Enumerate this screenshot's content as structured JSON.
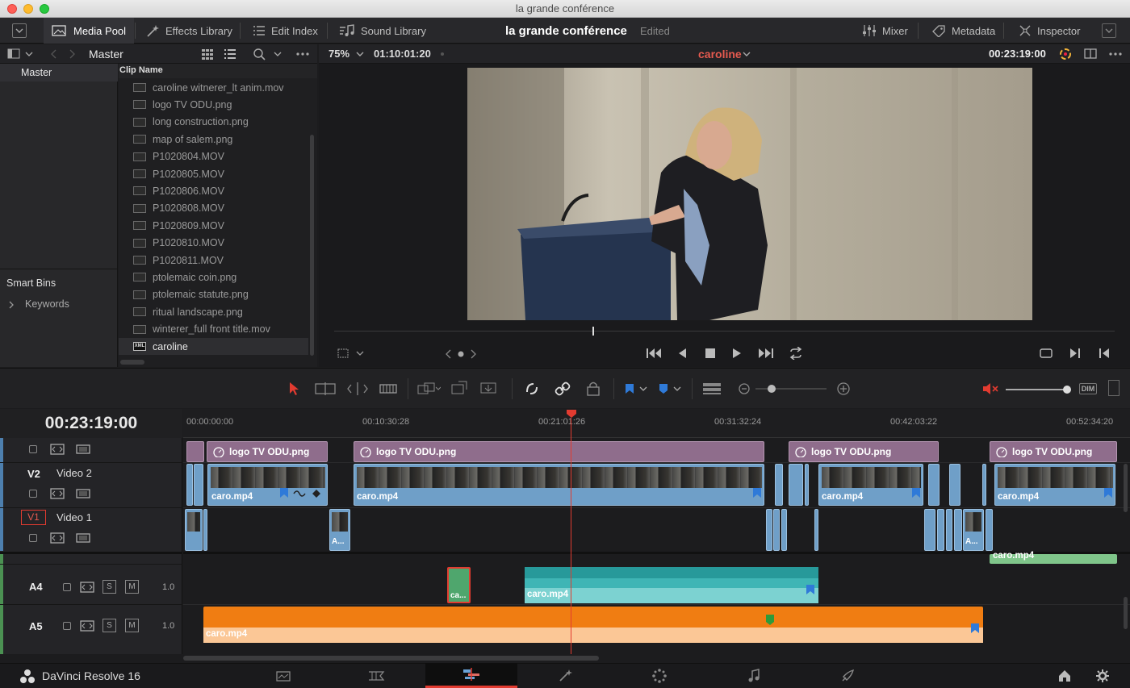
{
  "window": {
    "title": "la grande conférence"
  },
  "toolbar": {
    "media_pool": "Media Pool",
    "effects_library": "Effects Library",
    "edit_index": "Edit Index",
    "sound_library": "Sound Library",
    "project_title": "la grande conférence",
    "project_status": "Edited",
    "mixer": "Mixer",
    "metadata": "Metadata",
    "inspector": "Inspector"
  },
  "bins": {
    "current": "Master",
    "master": "Master",
    "smart_bins": "Smart Bins",
    "keywords": "Keywords",
    "column_header": "Clip Name"
  },
  "clips": [
    {
      "name": "caroline witnerer_lt anim.mov",
      "type": "clip"
    },
    {
      "name": "logo TV ODU.png",
      "type": "clip"
    },
    {
      "name": "long construction.png",
      "type": "clip"
    },
    {
      "name": "map of salem.png",
      "type": "clip"
    },
    {
      "name": "P1020804.MOV",
      "type": "clip"
    },
    {
      "name": "P1020805.MOV",
      "type": "clip"
    },
    {
      "name": "P1020806.MOV",
      "type": "clip"
    },
    {
      "name": "P1020808.MOV",
      "type": "clip"
    },
    {
      "name": "P1020809.MOV",
      "type": "clip"
    },
    {
      "name": "P1020810.MOV",
      "type": "clip"
    },
    {
      "name": "P1020811.MOV",
      "type": "clip"
    },
    {
      "name": "ptolemaic coin.png",
      "type": "clip"
    },
    {
      "name": "ptolemaic statute.png",
      "type": "clip"
    },
    {
      "name": "ritual landscape.png",
      "type": "clip"
    },
    {
      "name": "winterer_full front title.mov",
      "type": "clip"
    },
    {
      "name": "caroline",
      "type": "timeline",
      "badge": "XML"
    }
  ],
  "viewer": {
    "zoom": "75%",
    "source_timecode": "01:10:01:20",
    "timeline_name": "caroline",
    "record_timecode": "00:23:19:00"
  },
  "timeline": {
    "timecode": "00:23:19:00",
    "ruler_labels": [
      "00:00:00:00",
      "00:10:30:28",
      "00:21:01:26",
      "00:31:32:24",
      "00:42:03:22",
      "00:52:34:20"
    ],
    "dim_label": "DIM",
    "tracks": {
      "v2": {
        "id": "V2",
        "name": "Video 2"
      },
      "v1": {
        "id": "V1",
        "name": "Video 1"
      },
      "a4": {
        "id": "A4",
        "level": "1.0",
        "solo": "S",
        "mute": "M"
      },
      "a5": {
        "id": "A5",
        "level": "1.0",
        "solo": "S",
        "mute": "M"
      }
    },
    "clip_labels": {
      "title": "logo TV ODU.png",
      "video": "caro.mp4",
      "short_a": "A...",
      "short_ca": "ca...",
      "audio": "caro.mp4"
    }
  },
  "bottom": {
    "app_name": "DaVinci Resolve 16"
  },
  "colors": {
    "accent_red": "#e23b30",
    "video_clip": "#6f9fc8",
    "title_clip": "#8f6d8c",
    "audio_a4": "#3fb5b5",
    "audio_a5": "#f07d12"
  }
}
